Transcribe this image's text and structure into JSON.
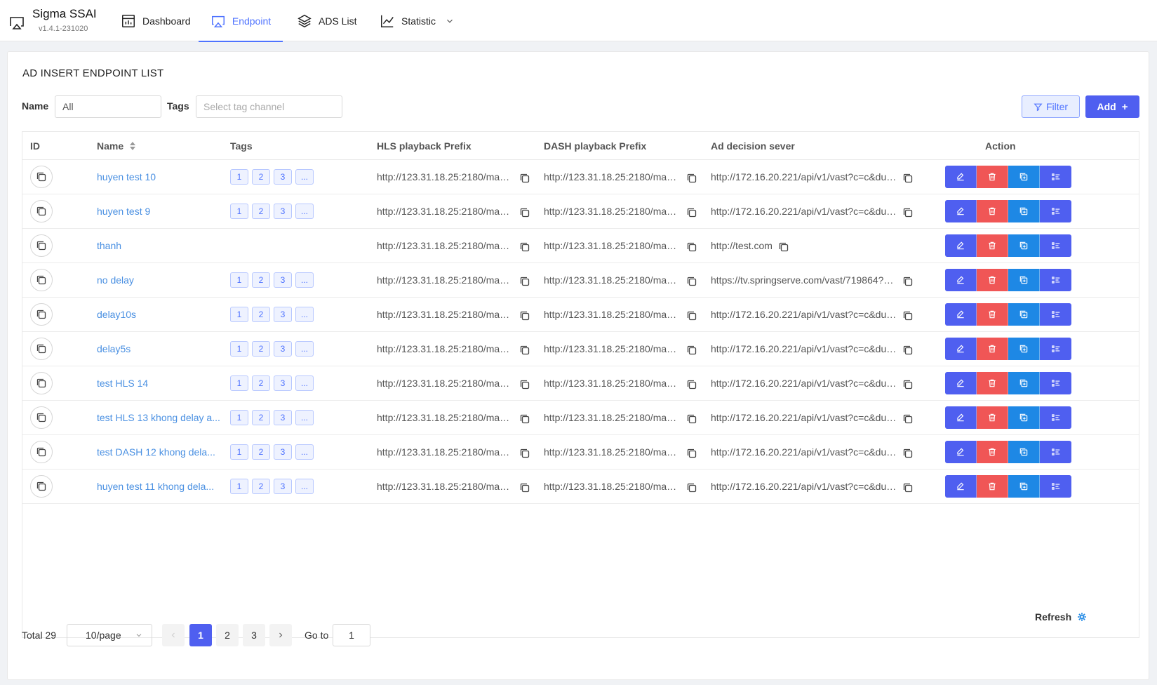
{
  "brand": {
    "name": "Sigma SSAI",
    "version": "v1.4.1-231020"
  },
  "nav": [
    {
      "label": "Dashboard",
      "icon": "dashboard-icon"
    },
    {
      "label": "Endpoint",
      "icon": "airplay-icon",
      "active": true
    },
    {
      "label": "ADS List",
      "icon": "layers-icon"
    },
    {
      "label": "Statistic",
      "icon": "line-chart-icon",
      "dropdown": true
    }
  ],
  "panel": {
    "title": "AD INSERT ENDPOINT LIST",
    "filters": {
      "name_label": "Name",
      "name_value": "All",
      "tags_label": "Tags",
      "tags_placeholder": "Select tag channel"
    },
    "filter_button": "Filter",
    "add_button": "Add"
  },
  "table": {
    "columns": [
      "ID",
      "Name",
      "Tags",
      "HLS playback Prefix",
      "DASH playback Prefix",
      "Ad decision sever",
      "Action"
    ],
    "rows": [
      {
        "name": "huyen test 10",
        "tags": [
          "1",
          "2",
          "3",
          "..."
        ],
        "hls": "http://123.31.18.25:2180/mani...",
        "dash": "http://123.31.18.25:2180/mani...",
        "ads": "http://172.16.20.221/api/v1/vast?c=c&dur..."
      },
      {
        "name": "huyen test 9",
        "tags": [
          "1",
          "2",
          "3",
          "..."
        ],
        "hls": "http://123.31.18.25:2180/mani...",
        "dash": "http://123.31.18.25:2180/mani...",
        "ads": "http://172.16.20.221/api/v1/vast?c=c&dur..."
      },
      {
        "name": "thanh",
        "tags": [],
        "hls": "http://123.31.18.25:2180/mani...",
        "dash": "http://123.31.18.25:2180/mani...",
        "ads": "http://test.com"
      },
      {
        "name": "no delay",
        "tags": [
          "1",
          "2",
          "3",
          "..."
        ],
        "hls": "http://123.31.18.25:2180/mani...",
        "dash": "http://123.31.18.25:2180/mani...",
        "ads": "https://tv.springserve.com/vast/719864?w..."
      },
      {
        "name": "delay10s",
        "tags": [
          "1",
          "2",
          "3",
          "..."
        ],
        "hls": "http://123.31.18.25:2180/mani...",
        "dash": "http://123.31.18.25:2180/mani...",
        "ads": "http://172.16.20.221/api/v1/vast?c=c&dur..."
      },
      {
        "name": "delay5s",
        "tags": [
          "1",
          "2",
          "3",
          "..."
        ],
        "hls": "http://123.31.18.25:2180/mani...",
        "dash": "http://123.31.18.25:2180/mani...",
        "ads": "http://172.16.20.221/api/v1/vast?c=c&dur..."
      },
      {
        "name": "test HLS 14",
        "tags": [
          "1",
          "2",
          "3",
          "..."
        ],
        "hls": "http://123.31.18.25:2180/mani...",
        "dash": "http://123.31.18.25:2180/mani...",
        "ads": "http://172.16.20.221/api/v1/vast?c=c&dur..."
      },
      {
        "name": "test HLS 13 khong delay a...",
        "tags": [
          "1",
          "2",
          "3",
          "..."
        ],
        "hls": "http://123.31.18.25:2180/mani...",
        "dash": "http://123.31.18.25:2180/mani...",
        "ads": "http://172.16.20.221/api/v1/vast?c=c&dur..."
      },
      {
        "name": "test DASH 12 khong dela...",
        "tags": [
          "1",
          "2",
          "3",
          "..."
        ],
        "hls": "http://123.31.18.25:2180/mani...",
        "dash": "http://123.31.18.25:2180/mani...",
        "ads": "http://172.16.20.221/api/v1/vast?c=c&dur..."
      },
      {
        "name": "huyen test 11 khong dela...",
        "tags": [
          "1",
          "2",
          "3",
          "..."
        ],
        "hls": "http://123.31.18.25:2180/mani...",
        "dash": "http://123.31.18.25:2180/mani...",
        "ads": "http://172.16.20.221/api/v1/vast?c=c&dur..."
      }
    ]
  },
  "pagination": {
    "total": "Total 29",
    "page_size": "10/page",
    "pages": [
      "1",
      "2",
      "3"
    ],
    "current": "1",
    "goto_label": "Go to",
    "goto_value": "1"
  },
  "refresh_label": "Refresh",
  "colors": {
    "primary": "#4f5ff0",
    "link": "#4a90e2",
    "danger": "#f05656",
    "clone": "#1e88e5"
  }
}
